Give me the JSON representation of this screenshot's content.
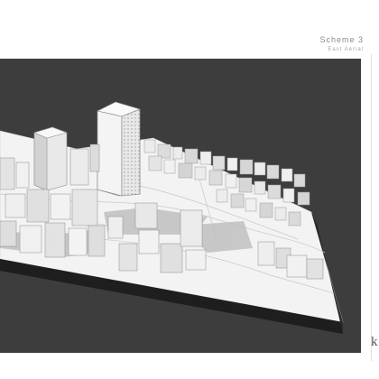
{
  "header": {
    "title": "Scheme 3",
    "subtitle": "East Aerial"
  },
  "page_mark": "k",
  "colors": {
    "background": "#ffffff",
    "panel": "#3d3d3d",
    "model_top": "#f2f2f2",
    "model_side": "#cfcfcf",
    "model_edge": "#a0a0a0",
    "shadow": "#b8b8b8",
    "base_side": "#1f1f1f"
  },
  "image": {
    "subject": "city-massing-model",
    "view": "aerial"
  }
}
